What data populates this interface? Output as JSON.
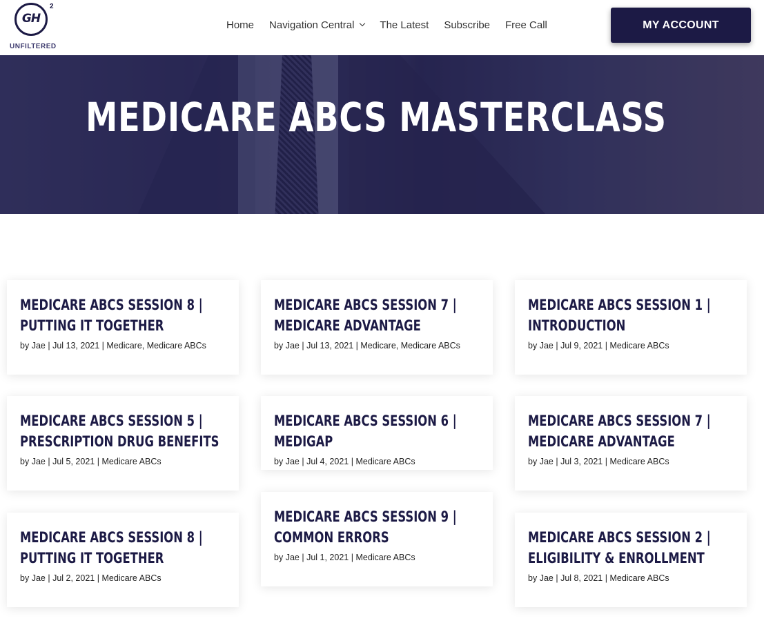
{
  "brand": {
    "logo_mark": "GH",
    "logo_sup": "2",
    "logo_tagline": "UNFILTERED"
  },
  "nav": {
    "items": [
      "Home",
      "Navigation Central",
      "The Latest",
      "Subscribe",
      "Free Call"
    ],
    "account_button": "MY ACCOUNT"
  },
  "hero": {
    "title": "MEDICARE ABCS MASTERCLASS"
  },
  "posts": [
    {
      "title": "Medicare ABCs Session 8 | Putting it together",
      "author": "Jae",
      "date": "Jul 13, 2021",
      "categories": "Medicare, Medicare ABCs"
    },
    {
      "title": "Medicare ABCs Session 7 | Medicare Advantage",
      "author": "Jae",
      "date": "Jul 13, 2021",
      "categories": "Medicare, Medicare ABCs"
    },
    {
      "title": "Medicare ABCs Session 1 | Introduction",
      "author": "Jae",
      "date": "Jul 9, 2021",
      "categories": "Medicare ABCs"
    },
    {
      "title": "Medicare ABCs Session 5 | Prescription Drug Benefits",
      "author": "Jae",
      "date": "Jul 5, 2021",
      "categories": "Medicare ABCs"
    },
    {
      "title": "Medicare ABCs Session 6 | Medigap",
      "author": "Jae",
      "date": "Jul 4, 2021",
      "categories": "Medicare ABCs"
    },
    {
      "title": "Medicare ABCs Session 7 | Medicare Advantage",
      "author": "Jae",
      "date": "Jul 3, 2021",
      "categories": "Medicare ABCs"
    },
    {
      "title": "Medicare ABCs Session 8 | Putting it together",
      "author": "Jae",
      "date": "Jul 2, 2021",
      "categories": "Medicare ABCs"
    },
    {
      "title": "Medicare ABCs Session 9 | Common Errors",
      "author": "Jae",
      "date": "Jul 1, 2021",
      "categories": "Medicare ABCs"
    },
    {
      "title": "Medicare ABCs Session 2 | Eligibility & Enrollment",
      "author": "Jae",
      "date": "Jul 8, 2021",
      "categories": "Medicare ABCs"
    }
  ],
  "labels": {
    "by": "by",
    "separator": "|"
  }
}
